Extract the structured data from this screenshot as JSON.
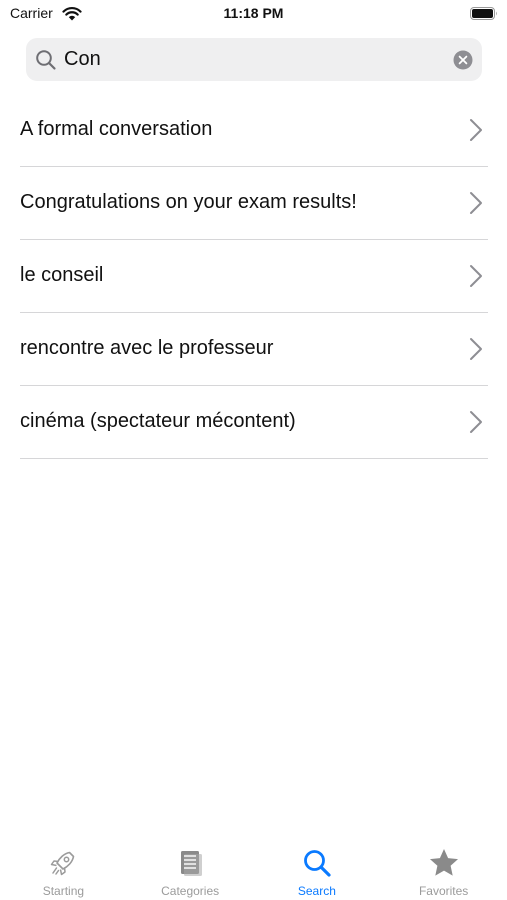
{
  "status_bar": {
    "carrier": "Carrier",
    "time": "11:18 PM"
  },
  "search": {
    "value": "Con",
    "icon": "search-icon",
    "clear_icon": "clear-icon"
  },
  "results": [
    {
      "label": "A formal conversation"
    },
    {
      "label": "Congratulations on your exam results!"
    },
    {
      "label": "le conseil"
    },
    {
      "label": "rencontre avec le professeur"
    },
    {
      "label": "cinéma (spectateur mécontent)"
    }
  ],
  "tab_bar": {
    "active": "Search",
    "tabs": [
      {
        "label": "Starting",
        "icon": "rocket-icon"
      },
      {
        "label": "Categories",
        "icon": "document-icon"
      },
      {
        "label": "Search",
        "icon": "search-icon"
      },
      {
        "label": "Favorites",
        "icon": "star-icon"
      }
    ]
  },
  "colors": {
    "accent": "#0a7aff",
    "inactive": "#9b9b9b",
    "search_background": "#efeff0",
    "separator": "#d6d6d8"
  }
}
